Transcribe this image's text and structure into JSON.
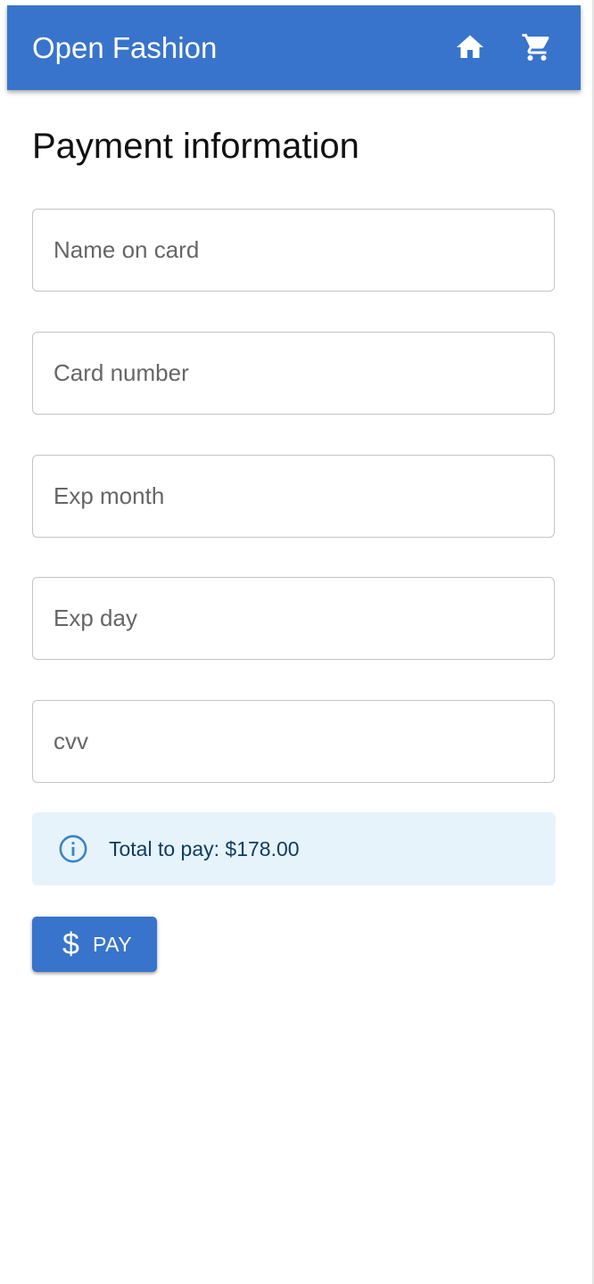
{
  "header": {
    "brand": "Open Fashion",
    "home_icon": "home-icon",
    "cart_icon": "shopping-cart-icon",
    "accent_color": "#3874cb"
  },
  "main": {
    "title": "Payment information",
    "fields": [
      {
        "placeholder": "Name on card",
        "value": ""
      },
      {
        "placeholder": "Card number",
        "value": ""
      },
      {
        "placeholder": "Exp month",
        "value": ""
      },
      {
        "placeholder": "Exp day",
        "value": ""
      },
      {
        "placeholder": "cvv",
        "value": ""
      }
    ],
    "alert": {
      "icon": "info-icon",
      "text": "Total to pay: $178.00",
      "background": "#e6f3fb"
    },
    "pay_button": {
      "icon": "dollar-icon",
      "icon_glyph": "$",
      "label": "PAY"
    }
  }
}
